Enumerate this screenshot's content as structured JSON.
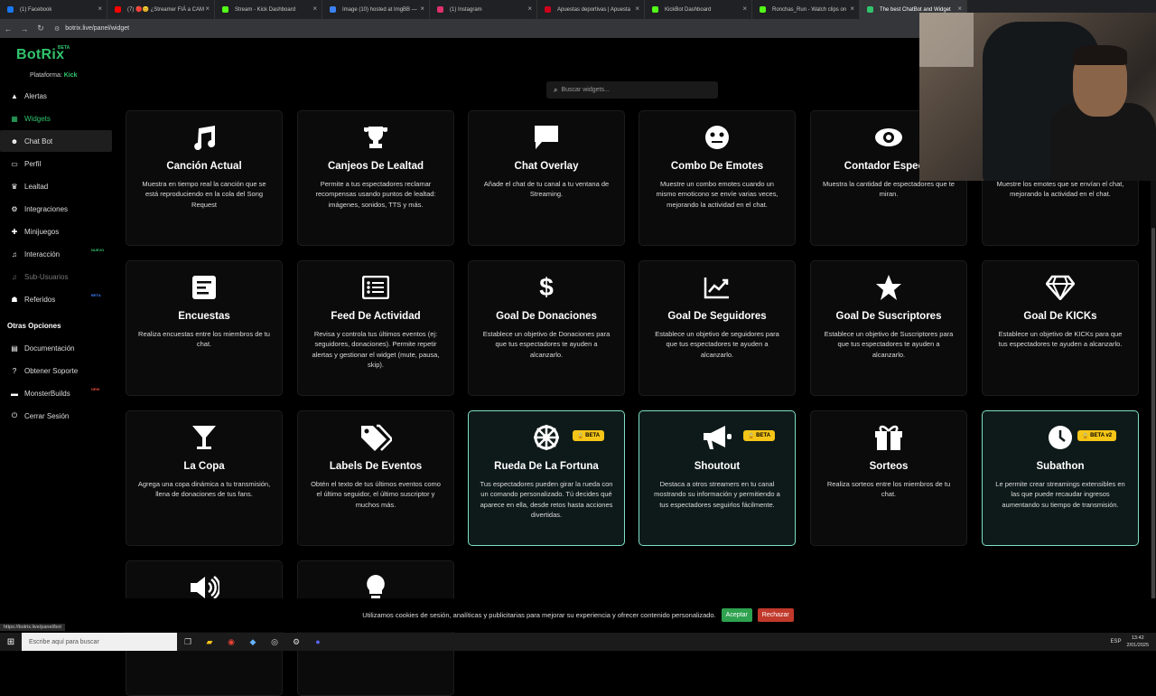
{
  "browser": {
    "tabs": [
      {
        "label": "(1) Facebook",
        "color": "#1877f2"
      },
      {
        "label": "(7) 🔴😊 ¿Streamer FIÁ a CAM",
        "color": "#ff0000"
      },
      {
        "label": "Stream - Kick Dashboard",
        "color": "#53fc18"
      },
      {
        "label": "Image (10) hosted at ImgBB —",
        "color": "#3b82f6"
      },
      {
        "label": "(1) Instagram",
        "color": "#e1306c"
      },
      {
        "label": "Apuestas deportivas | Apuesta",
        "color": "#d0021b"
      },
      {
        "label": "KickBot Dashboard",
        "color": "#53fc18"
      },
      {
        "label": "Ronchas_Run - Watch clips on",
        "color": "#53fc18"
      },
      {
        "label": "The best ChatBot and Widget",
        "color": "#31c46d"
      }
    ],
    "url": "botrix.live/panel/widget",
    "status_url": "https://botrix.live/panel/bot"
  },
  "sidebar": {
    "logo": "BotRix",
    "logo_beta": "BETA",
    "platform_label": "Plataforma:",
    "platform_value": "Kick",
    "items": [
      {
        "label": "Alertas",
        "icon": "warning-icon"
      },
      {
        "label": "Widgets",
        "icon": "grid-icon"
      },
      {
        "label": "Chat Bot",
        "icon": "robot-icon"
      },
      {
        "label": "Perfil",
        "icon": "id-card-icon"
      },
      {
        "label": "Lealtad",
        "icon": "trophy-icon"
      },
      {
        "label": "Integraciones",
        "icon": "gear-icon"
      },
      {
        "label": "Minijuegos",
        "icon": "gamepad-icon"
      },
      {
        "label": "Interacción",
        "icon": "music-icon",
        "tag": "NUEVO"
      },
      {
        "label": "Sub-Usuarios",
        "icon": "music-icon"
      },
      {
        "label": "Referidos",
        "icon": "users-icon",
        "tag": "BETA"
      }
    ],
    "other_heading": "Otras Opciones",
    "other_items": [
      {
        "label": "Documentación",
        "icon": "book-icon"
      },
      {
        "label": "Obtener Soporte",
        "icon": "help-icon"
      },
      {
        "label": "MonsterBuilds",
        "icon": "monitor-icon",
        "tag": "NEW"
      },
      {
        "label": "Cerrar Sesión",
        "icon": "logout-icon"
      }
    ],
    "colors": {
      "accent": "#31c46d",
      "tag_new": "#31c46d",
      "tag_beta": "#3b82f6",
      "tag_hot": "#e74c3c"
    }
  },
  "search": {
    "placeholder": "Buscar widgets..."
  },
  "widgets": [
    {
      "title": "Canción Actual",
      "icon": "music-note-icon",
      "desc": "Muestra en tiempo real la canción que se está reproduciendo en la cola del Song Request"
    },
    {
      "title": "Canjeos De Lealtad",
      "icon": "trophy-icon",
      "desc": "Permite a tus espectadores reclamar recompensas usando puntos de lealtad: imágenes, sonidos, TTS y más."
    },
    {
      "title": "Chat Overlay",
      "icon": "chat-icon",
      "desc": "Añade el chat de tu canal a tu ventana de Streaming."
    },
    {
      "title": "Combo De Emotes",
      "icon": "face-icon",
      "desc": "Muestre un combo emotes cuando un mismo emoticono se envíe varias veces, mejorando la actividad en el chat."
    },
    {
      "title": "Contador Especta",
      "icon": "eye-icon",
      "desc": "Muestra la cantidad de espectadores que te miran."
    },
    {
      "title": "",
      "icon": "",
      "desc": "Muestre los emotes que se envían el chat, mejorando la actividad en el chat."
    },
    {
      "title": "Encuestas",
      "icon": "poll-icon",
      "desc": "Realiza encuestas entre los miembros de tu chat."
    },
    {
      "title": "Feed De Actividad",
      "icon": "list-icon",
      "desc": "Revisa y controla tus últimos eventos (ej: seguidores, donaciones). Permite repetir alertas y gestionar el widget (mute, pausa, skip)."
    },
    {
      "title": "Goal De Donaciones",
      "icon": "dollar-icon",
      "desc": "Establece un objetivo de Donaciones para que tus espectadores te ayuden a alcanzarlo."
    },
    {
      "title": "Goal De Seguidores",
      "icon": "chart-line-icon",
      "desc": "Establece un objetivo de seguidores para que tus espectadores te ayuden a alcanzarlo."
    },
    {
      "title": "Goal De Suscriptores",
      "icon": "star-icon",
      "desc": "Establece un objetivo de Suscriptores para que tus espectadores te ayuden a alcanzarlo."
    },
    {
      "title": "Goal De KICKs",
      "icon": "diamond-icon",
      "desc": "Establece un objetivo de KICKs para que tus espectadores te ayuden a alcanzarlo."
    },
    {
      "title": "La Copa",
      "icon": "cocktail-icon",
      "desc": "Agrega una copa dinámica a tu transmisión, llena de donaciones de tus fans."
    },
    {
      "title": "Labels De Eventos",
      "icon": "tags-icon",
      "desc": "Obtén el texto de tus últimos eventos como el último seguidor, el último suscriptor y muchos más."
    },
    {
      "title": "Rueda De La Fortuna",
      "icon": "wheel-icon",
      "desc": "Tus espectadores pueden girar la rueda con un comando personalizado. Tú decides qué aparece en ella, desde retos hasta acciones divertidas.",
      "badge": "BETA"
    },
    {
      "title": "Shoutout",
      "icon": "megaphone-icon",
      "desc": "Destaca a otros streamers en tu canal mostrando su información y permitiendo a tus espectadores seguirlos fácilmente.",
      "badge": "BETA"
    },
    {
      "title": "Sorteos",
      "icon": "gift-icon",
      "desc": "Realiza sorteos entre los miembros de tu chat."
    },
    {
      "title": "Subathon",
      "icon": "clock-icon",
      "desc": "Le permite crear streamings extensibles en las que puede recaudar ingresos aumentando su tiempo de transmisión.",
      "badge": "BETA v2"
    },
    {
      "title": "",
      "icon": "speaker-icon",
      "desc": ""
    },
    {
      "title": "",
      "icon": "lightbulb-icon",
      "desc": ""
    }
  ],
  "cookie": {
    "text": "Utilizamos cookies de sesión, analíticas y publicitarias para mejorar su experiencia y ofrecer contenido personalizado.",
    "accept": "Aceptar",
    "reject": "Rechazar"
  },
  "taskbar": {
    "search_placeholder": "Escribe aquí para buscar",
    "lang": "ESP",
    "time": "13:42",
    "date": "2/01/2025"
  }
}
